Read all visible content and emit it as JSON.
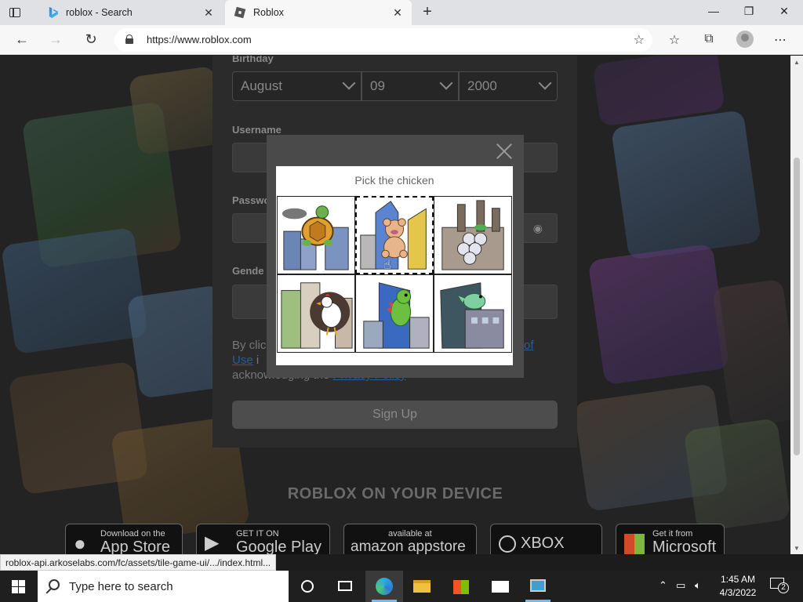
{
  "browser": {
    "tabs": [
      {
        "title": "roblox - Search"
      },
      {
        "title": "Roblox"
      }
    ],
    "url": "https://www.roblox.com"
  },
  "signup": {
    "birthday_label": "Birthday",
    "month": "August",
    "day": "09",
    "year": "2000",
    "username_label": "Username",
    "password_label": "Passwo",
    "gender_label": "Gende",
    "terms": {
      "prefix": "By clic",
      "use_link": "Use",
      "middle": "i",
      "of_link": "of",
      "line3": "acknowledging the",
      "privacy_link": "Privacy Policy"
    },
    "signup_button": "Sign Up"
  },
  "device_section": {
    "heading": "ROBLOX ON YOUR DEVICE",
    "stores": [
      {
        "small": "Download on the",
        "big": "App Store"
      },
      {
        "small": "GET IT ON",
        "big": "Google Play"
      },
      {
        "small": "available at",
        "big": "amazon appstore"
      },
      {
        "small": "",
        "big": "XBOX ONE"
      },
      {
        "small": "Get it from",
        "big": "Microsoft"
      }
    ]
  },
  "captcha": {
    "prompt": "Pick the chicken",
    "tiles": [
      {
        "subject": "turtle"
      },
      {
        "subject": "teddy bear"
      },
      {
        "subject": "grapes"
      },
      {
        "subject": "chicken"
      },
      {
        "subject": "dinosaur"
      },
      {
        "subject": "dinosaur"
      }
    ],
    "selected_index": 1
  },
  "status_bar": "roblox-api.arkoselabs.com/fc/assets/tile-game-ui/.../index.html...",
  "taskbar": {
    "search_placeholder": "Type here to search",
    "time": "1:45 AM",
    "date": "4/3/2022",
    "notification_count": "2"
  },
  "colors": {
    "captcha_frame": "#4a4a4a",
    "link": "#2c5b95",
    "taskbar": "#1f1f1f"
  }
}
